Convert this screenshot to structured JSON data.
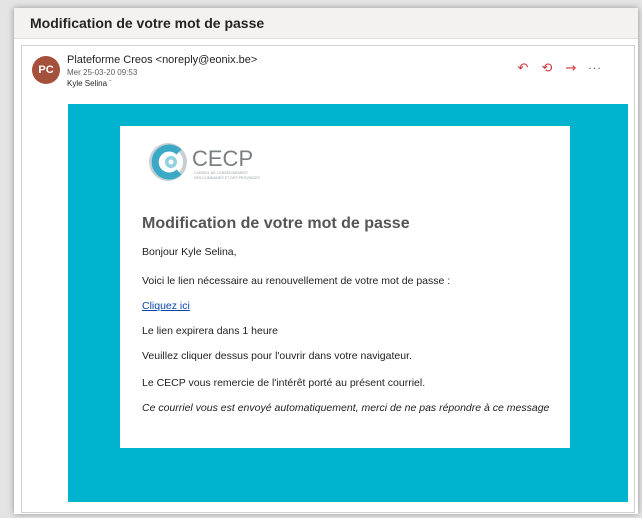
{
  "email": {
    "subject": "Modification de votre mot de passe",
    "avatar_initials": "PC",
    "sender": "Plateforme Creos <noreply@eonix.be>",
    "date": "Mer 25-03-20 09:53",
    "recipient": "Kyle Selina",
    "actions": {
      "reply": "↶",
      "reply_all": "⟲",
      "forward": "→",
      "more": "···"
    }
  },
  "body": {
    "logo_text": "CECP",
    "logo_subtext_1": "CONSEIL DE L'ENSEIGNEMENT",
    "logo_subtext_2": "DES COMMUNES ET DES PROVINCES",
    "heading": "Modification de votre mot de passe",
    "greeting": "Bonjour Kyle Selina,",
    "intro": "Voici le lien nécessaire au renouvellement de votre mot de passe :",
    "link_label": "Cliquez ici",
    "expiry": "Le lien expirera dans 1 heure",
    "instruction": "Veuillez cliquer dessus pour l'ouvrir dans votre navigateur.",
    "thanks": "Le CECP vous remercie de l'intérêt porté au présent courriel.",
    "footer": "Ce courriel vous est envoyé automatiquement, merci de ne pas répondre à ce message"
  },
  "colors": {
    "accent_teal": "#00b4cf",
    "avatar": "#a4503a",
    "action_red": "#d13438"
  }
}
